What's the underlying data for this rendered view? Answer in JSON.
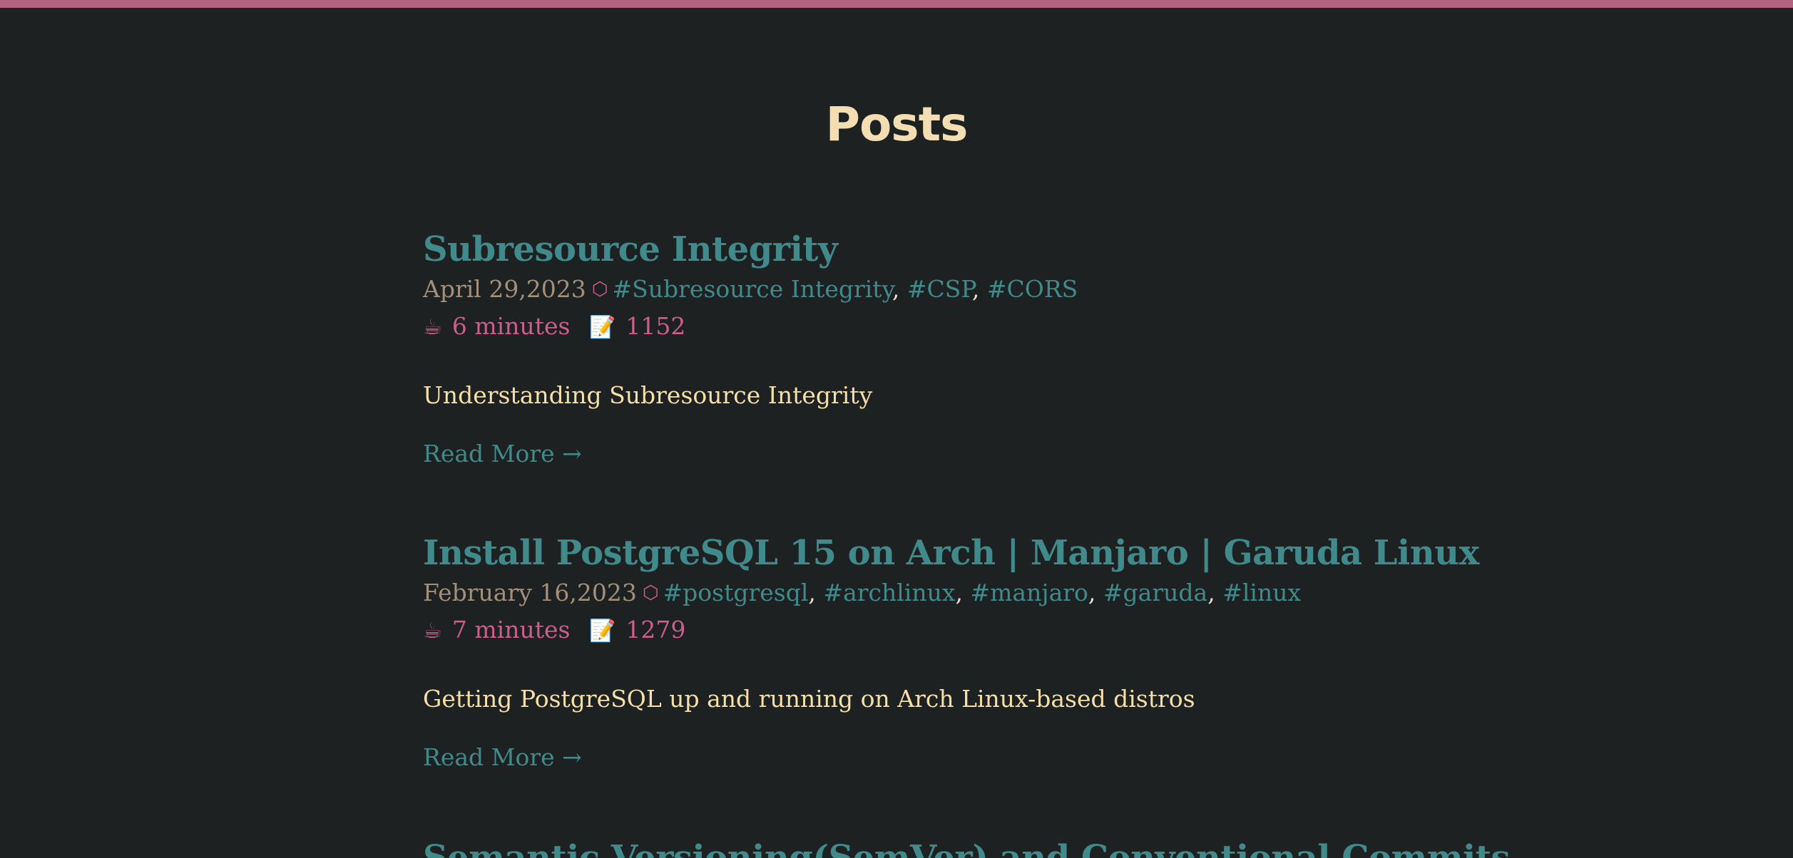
{
  "page": {
    "title": "Posts"
  },
  "colors": {
    "background": "#1e2122",
    "top_bar": "#b2617f",
    "heading": "#f2deb2",
    "link": "#418a8c",
    "accent": "#cc5e8c",
    "date": "#a3907a",
    "summary": "#f5dfa8"
  },
  "icons": {
    "tag": "hexagon-outline",
    "read_time": "coffee-cup-emoji",
    "word_count": "memo-emoji"
  },
  "posts": [
    {
      "title": "Subresource Integrity",
      "date": "April 29,2023",
      "tag_icon": "⬡",
      "tags": [
        "#Subresource Integrity",
        "#CSP",
        "#CORS"
      ],
      "read_time_icon": "☕",
      "read_time": "6 minutes",
      "word_count_icon": "📝",
      "word_count": "1152",
      "summary": "Understanding Subresource Integrity",
      "read_more": "Read More →"
    },
    {
      "title": "Install PostgreSQL 15 on Arch | Manjaro | Garuda Linux",
      "date": "February 16,2023",
      "tag_icon": "⬡",
      "tags": [
        "#postgresql",
        "#archlinux",
        "#manjaro",
        "#garuda",
        "#linux"
      ],
      "read_time_icon": "☕",
      "read_time": "7 minutes",
      "word_count_icon": "📝",
      "word_count": "1279",
      "summary": "Getting PostgreSQL up and running on Arch Linux-based distros",
      "read_more": "Read More →"
    },
    {
      "title": "Semantic Versioning(SemVer) and Conventional Commits"
    }
  ],
  "separator": ","
}
